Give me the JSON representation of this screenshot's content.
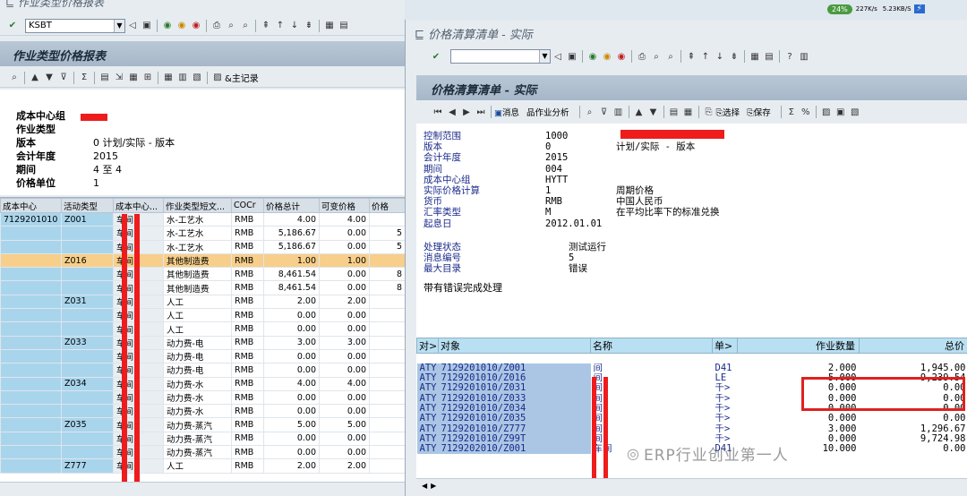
{
  "left_window": {
    "title": "作业类型价格报表",
    "command_field": "KSBT",
    "header_title": "作业类型价格报表",
    "master_record_label": "主记录",
    "info": [
      {
        "label": "成本中心组",
        "value": ""
      },
      {
        "label": "作业类型",
        "value": ""
      },
      {
        "label": "版本",
        "value": "0 计划/实际 - 版本"
      },
      {
        "label": "会计年度",
        "value": "2015"
      },
      {
        "label": "期间",
        "value": "4 至 4"
      },
      {
        "label": "价格单位",
        "value": "1"
      }
    ],
    "columns": [
      "成本中心",
      "活动类型",
      "成本中心...",
      "作业类型短文...",
      "COCr",
      "价格总计",
      "可变价格",
      "价格"
    ],
    "rows": [
      {
        "cc": "7129201010",
        "at": "Z001",
        "ccn": "车间",
        "short": "水-工艺水",
        "cur": "RMB",
        "total": "4.00",
        "var": "4.00",
        "p": ""
      },
      {
        "cc": "",
        "at": "",
        "ccn": "车间",
        "short": "水-工艺水",
        "cur": "RMB",
        "total": "5,186.67",
        "var": "0.00",
        "p": "5"
      },
      {
        "cc": "",
        "at": "",
        "ccn": "车间",
        "short": "水-工艺水",
        "cur": "RMB",
        "total": "5,186.67",
        "var": "0.00",
        "p": "5"
      },
      {
        "cc": "",
        "at": "Z016",
        "ccn": "车间",
        "short": "其他制造费",
        "cur": "RMB",
        "total": "1.00",
        "var": "1.00",
        "p": "",
        "highlight": true
      },
      {
        "cc": "",
        "at": "",
        "ccn": "车间",
        "short": "其他制造费",
        "cur": "RMB",
        "total": "8,461.54",
        "var": "0.00",
        "p": "8"
      },
      {
        "cc": "",
        "at": "",
        "ccn": "车间",
        "short": "其他制造费",
        "cur": "RMB",
        "total": "8,461.54",
        "var": "0.00",
        "p": "8"
      },
      {
        "cc": "",
        "at": "Z031",
        "ccn": "车间",
        "short": "人工",
        "cur": "RMB",
        "total": "2.00",
        "var": "2.00",
        "p": ""
      },
      {
        "cc": "",
        "at": "",
        "ccn": "车间",
        "short": "人工",
        "cur": "RMB",
        "total": "0.00",
        "var": "0.00",
        "p": ""
      },
      {
        "cc": "",
        "at": "",
        "ccn": "车间",
        "short": "人工",
        "cur": "RMB",
        "total": "0.00",
        "var": "0.00",
        "p": ""
      },
      {
        "cc": "",
        "at": "Z033",
        "ccn": "车间",
        "short": "动力费-电",
        "cur": "RMB",
        "total": "3.00",
        "var": "3.00",
        "p": ""
      },
      {
        "cc": "",
        "at": "",
        "ccn": "车间",
        "short": "动力费-电",
        "cur": "RMB",
        "total": "0.00",
        "var": "0.00",
        "p": ""
      },
      {
        "cc": "",
        "at": "",
        "ccn": "车间",
        "short": "动力费-电",
        "cur": "RMB",
        "total": "0.00",
        "var": "0.00",
        "p": ""
      },
      {
        "cc": "",
        "at": "Z034",
        "ccn": "车间",
        "short": "动力费-水",
        "cur": "RMB",
        "total": "4.00",
        "var": "4.00",
        "p": ""
      },
      {
        "cc": "",
        "at": "",
        "ccn": "车间",
        "short": "动力费-水",
        "cur": "RMB",
        "total": "0.00",
        "var": "0.00",
        "p": ""
      },
      {
        "cc": "",
        "at": "",
        "ccn": "车间",
        "short": "动力费-水",
        "cur": "RMB",
        "total": "0.00",
        "var": "0.00",
        "p": ""
      },
      {
        "cc": "",
        "at": "Z035",
        "ccn": "车间",
        "short": "动力费-蒸汽",
        "cur": "RMB",
        "total": "5.00",
        "var": "5.00",
        "p": ""
      },
      {
        "cc": "",
        "at": "",
        "ccn": "车间",
        "short": "动力费-蒸汽",
        "cur": "RMB",
        "total": "0.00",
        "var": "0.00",
        "p": ""
      },
      {
        "cc": "",
        "at": "",
        "ccn": "车间",
        "short": "动力费-蒸汽",
        "cur": "RMB",
        "total": "0.00",
        "var": "0.00",
        "p": ""
      },
      {
        "cc": "",
        "at": "Z777",
        "ccn": "车间",
        "short": "人工",
        "cur": "RMB",
        "total": "2.00",
        "var": "2.00",
        "p": ""
      }
    ]
  },
  "right_window": {
    "title": "价格清算清单 - 实际",
    "header_title": "价格清算清单 - 实际",
    "toolbar": {
      "message": "消息",
      "activity_analysis": "作业分析",
      "select": "选择",
      "save": "保存"
    },
    "details": [
      {
        "label": "控制范围",
        "value": "1000",
        "text": ""
      },
      {
        "label": "版本",
        "value": "0",
        "text": "计划/实际 - 版本"
      },
      {
        "label": "会计年度",
        "value": "2015",
        "text": ""
      },
      {
        "label": "期间",
        "value": "004",
        "text": ""
      },
      {
        "label": "成本中心组",
        "value": "HYTT",
        "text": ""
      },
      {
        "label": "实际价格计算",
        "value": "1",
        "text": "周期价格"
      },
      {
        "label": "货币",
        "value": "RMB",
        "text": "中国人民币"
      },
      {
        "label": "汇率类型",
        "value": "M",
        "text": "在平均比率下的标准兑换"
      },
      {
        "label": "起息日",
        "value": "2012.01.01",
        "text": ""
      }
    ],
    "process": [
      {
        "label": "处理状态",
        "value": "测试运行"
      },
      {
        "label": "消息编号",
        "value": "5"
      },
      {
        "label": "最大目录",
        "value": "错误"
      }
    ],
    "completion_text": "带有错误完成处理",
    "columns": {
      "pair": "对>",
      "object": "对象",
      "name": "名称",
      "unit": "单>",
      "qty": "作业数量",
      "total": "总价"
    },
    "rows": [
      {
        "pair": "ATY",
        "object": "7129201010/Z001",
        "name": "间",
        "unit": "D41",
        "qty": "2.000",
        "total": "1,945.00"
      },
      {
        "pair": "ATY",
        "object": "7129201010/Z016",
        "name": "间",
        "unit": "LE",
        "qty": "5.000",
        "total": "9,239.54"
      },
      {
        "pair": "ATY",
        "object": "7129201010/Z031",
        "name": "间",
        "unit": "千>",
        "qty": "0.000",
        "total": "0.00"
      },
      {
        "pair": "ATY",
        "object": "7129201010/Z033",
        "name": "间",
        "unit": "千>",
        "qty": "0.000",
        "total": "0.00"
      },
      {
        "pair": "ATY",
        "object": "7129201010/Z034",
        "name": "间",
        "unit": "千>",
        "qty": "0.000",
        "total": "0.00"
      },
      {
        "pair": "ATY",
        "object": "7129201010/Z035",
        "name": "间",
        "unit": "千>",
        "qty": "0.000",
        "total": "0.00"
      },
      {
        "pair": "ATY",
        "object": "7129201010/Z777",
        "name": "间",
        "unit": "千>",
        "qty": "3.000",
        "total": "1,296.67"
      },
      {
        "pair": "ATY",
        "object": "7129201010/Z99T",
        "name": "间",
        "unit": "千>",
        "qty": "0.000",
        "total": "9,724.98"
      },
      {
        "pair": "ATY",
        "object": "7129202010/Z001",
        "name": "车间",
        "unit": "D41",
        "qty": "10.000",
        "total": "0.00"
      }
    ]
  },
  "network": {
    "percent": "24%",
    "up": "227K/s",
    "down": "5.23KB/S"
  },
  "watermark": "ERP行业创业第一人"
}
